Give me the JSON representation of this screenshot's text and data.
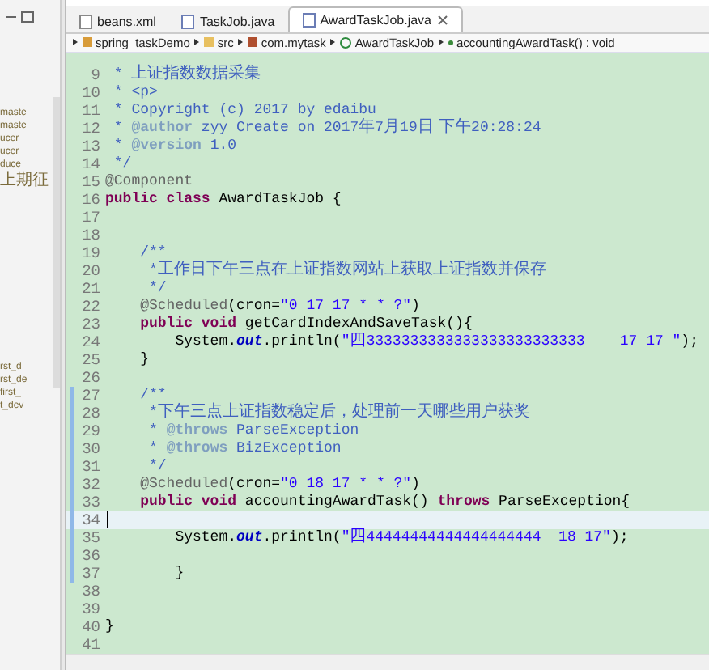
{
  "side_panel": {
    "top_items": [
      "maste",
      "maste",
      "ucer",
      "ucer",
      "duce",
      "上期征"
    ],
    "bottom_items": [
      "rst_d",
      "rst_de",
      "first_",
      "t_dev"
    ]
  },
  "tabs": [
    {
      "label": "beans.xml",
      "kind": "xml",
      "selected": false
    },
    {
      "label": "TaskJob.java",
      "kind": "java",
      "selected": false
    },
    {
      "label": "AwardTaskJob.java",
      "kind": "java",
      "selected": true
    }
  ],
  "breadcrumb": [
    {
      "label": "spring_taskDemo",
      "kind": "project"
    },
    {
      "label": "src",
      "kind": "folder"
    },
    {
      "label": "com.mytask",
      "kind": "package"
    },
    {
      "label": "AwardTaskJob",
      "kind": "class"
    },
    {
      "label": "accountingAwardTask() : void",
      "kind": "method"
    }
  ],
  "lines": [
    {
      "number": "9",
      "changed": false,
      "current": false,
      "segments": [
        {
          "kind": "javadoc",
          "text": " * "
        },
        {
          "kind": "cjk-javadoc",
          "text": "上证指数数据采集"
        }
      ]
    },
    {
      "number": "10",
      "changed": false,
      "current": false,
      "segments": [
        {
          "kind": "javadoc",
          "text": " * <p>"
        }
      ]
    },
    {
      "number": "11",
      "changed": false,
      "current": false,
      "segments": [
        {
          "kind": "javadoc",
          "text": " * Copyright (c) 2017 by edaibu"
        }
      ]
    },
    {
      "number": "12",
      "changed": false,
      "current": false,
      "segments": [
        {
          "kind": "javadoc",
          "text": " * "
        },
        {
          "kind": "javadoc-tag",
          "text": "@author"
        },
        {
          "kind": "javadoc",
          "text": " zyy Create on 2017"
        },
        {
          "kind": "cjk-javadoc",
          "text": "年"
        },
        {
          "kind": "javadoc",
          "text": "7"
        },
        {
          "kind": "cjk-javadoc",
          "text": "月"
        },
        {
          "kind": "javadoc",
          "text": "19"
        },
        {
          "kind": "cjk-javadoc",
          "text": "日 下午"
        },
        {
          "kind": "javadoc",
          "text": "20:28:24"
        }
      ]
    },
    {
      "number": "13",
      "changed": false,
      "current": false,
      "segments": [
        {
          "kind": "javadoc",
          "text": " * "
        },
        {
          "kind": "javadoc-tag",
          "text": "@version"
        },
        {
          "kind": "javadoc",
          "text": " 1.0"
        }
      ]
    },
    {
      "number": "14",
      "changed": false,
      "current": false,
      "segments": [
        {
          "kind": "javadoc",
          "text": " */"
        }
      ]
    },
    {
      "number": "15",
      "changed": false,
      "current": false,
      "segments": [
        {
          "kind": "annotation",
          "text": "@Component"
        }
      ]
    },
    {
      "number": "16",
      "changed": false,
      "current": false,
      "segments": [
        {
          "kind": "keyword",
          "text": "public class"
        },
        {
          "kind": "plain",
          "text": " AwardTaskJob {"
        }
      ]
    },
    {
      "number": "17",
      "changed": false,
      "current": false
    },
    {
      "number": "18",
      "changed": false,
      "current": false
    },
    {
      "number": "19",
      "changed": false,
      "current": false,
      "segments": [
        {
          "kind": "javadoc",
          "text": "    /**"
        }
      ]
    },
    {
      "number": "20",
      "changed": false,
      "current": false,
      "segments": [
        {
          "kind": "javadoc",
          "text": "     *"
        },
        {
          "kind": "cjk-javadoc",
          "text": "工作日下午三点在上证指数网站上获取上证指数并保存"
        }
      ]
    },
    {
      "number": "21",
      "changed": false,
      "current": false,
      "segments": [
        {
          "kind": "javadoc",
          "text": "     */"
        }
      ]
    },
    {
      "number": "22",
      "changed": false,
      "current": false,
      "segments": [
        {
          "kind": "annotation",
          "text": "    @Scheduled"
        },
        {
          "kind": "plain",
          "text": "(cron="
        },
        {
          "kind": "string",
          "text": "\"0 17 17 * * ?\""
        },
        {
          "kind": "plain",
          "text": ")"
        }
      ]
    },
    {
      "number": "23",
      "changed": false,
      "current": false,
      "segments": [
        {
          "kind": "keyword",
          "text": "    public void"
        },
        {
          "kind": "plain",
          "text": " getCardIndexAndSaveTask(){"
        }
      ]
    },
    {
      "number": "24",
      "changed": false,
      "current": false,
      "segments": [
        {
          "kind": "plain",
          "text": "        System."
        },
        {
          "kind": "field",
          "text": "out"
        },
        {
          "kind": "plain",
          "text": ".println("
        },
        {
          "kind": "string",
          "text": "\""
        },
        {
          "kind": "cjk-string",
          "text": "四"
        },
        {
          "kind": "string",
          "text": "3333333333333333333333333    17 17 \""
        },
        {
          "kind": "plain",
          "text": ");"
        }
      ]
    },
    {
      "number": "25",
      "changed": false,
      "current": false,
      "segments": [
        {
          "kind": "plain",
          "text": "    }"
        }
      ]
    },
    {
      "number": "26",
      "changed": false,
      "current": false
    },
    {
      "number": "27",
      "changed": true,
      "current": false,
      "segments": [
        {
          "kind": "javadoc",
          "text": "    /**"
        }
      ]
    },
    {
      "number": "28",
      "changed": true,
      "current": false,
      "segments": [
        {
          "kind": "javadoc",
          "text": "     *"
        },
        {
          "kind": "cjk-javadoc",
          "text": "下午三点上证指数稳定后，处理前一天哪些用户获奖"
        }
      ]
    },
    {
      "number": "29",
      "changed": true,
      "current": false,
      "segments": [
        {
          "kind": "javadoc",
          "text": "     * "
        },
        {
          "kind": "javadoc-tag",
          "text": "@throws"
        },
        {
          "kind": "javadoc",
          "text": " ParseException"
        }
      ]
    },
    {
      "number": "30",
      "changed": true,
      "current": false,
      "segments": [
        {
          "kind": "javadoc",
          "text": "     * "
        },
        {
          "kind": "javadoc-tag",
          "text": "@throws"
        },
        {
          "kind": "javadoc",
          "text": " BizException"
        }
      ]
    },
    {
      "number": "31",
      "changed": true,
      "current": false,
      "segments": [
        {
          "kind": "javadoc",
          "text": "     */"
        }
      ]
    },
    {
      "number": "32",
      "changed": true,
      "current": false,
      "segments": [
        {
          "kind": "annotation",
          "text": "    @Scheduled"
        },
        {
          "kind": "plain",
          "text": "(cron="
        },
        {
          "kind": "string",
          "text": "\"0 18 17 * * ?\""
        },
        {
          "kind": "plain",
          "text": ")"
        }
      ]
    },
    {
      "number": "33",
      "changed": true,
      "current": false,
      "segments": [
        {
          "kind": "keyword",
          "text": "    public void"
        },
        {
          "kind": "plain",
          "text": " accountingAwardTask() "
        },
        {
          "kind": "keyword",
          "text": "throws"
        },
        {
          "kind": "plain",
          "text": " ParseException{"
        }
      ]
    },
    {
      "number": "34",
      "changed": true,
      "current": true
    },
    {
      "number": "35",
      "changed": true,
      "current": false,
      "segments": [
        {
          "kind": "plain",
          "text": "        System."
        },
        {
          "kind": "field",
          "text": "out"
        },
        {
          "kind": "plain",
          "text": ".println("
        },
        {
          "kind": "string",
          "text": "\""
        },
        {
          "kind": "cjk-string",
          "text": "四"
        },
        {
          "kind": "string",
          "text": "44444444444444444444  18 17\""
        },
        {
          "kind": "plain",
          "text": ");"
        }
      ]
    },
    {
      "number": "36",
      "changed": true,
      "current": false
    },
    {
      "number": "37",
      "changed": true,
      "current": false,
      "segments": [
        {
          "kind": "plain",
          "text": "        }"
        }
      ]
    },
    {
      "number": "38",
      "changed": false,
      "current": false
    },
    {
      "number": "39",
      "changed": false,
      "current": false
    },
    {
      "number": "40",
      "changed": false,
      "current": false,
      "segments": [
        {
          "kind": "plain",
          "text": "}"
        }
      ]
    },
    {
      "number": "41",
      "changed": false,
      "current": false
    }
  ]
}
